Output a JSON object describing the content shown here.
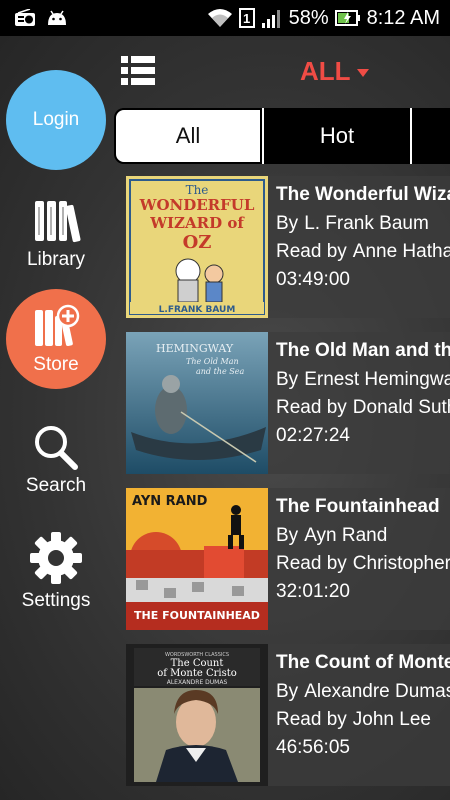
{
  "status": {
    "battery": "58%",
    "time": "8:12 AM",
    "sim": "1"
  },
  "header": {
    "filter": "ALL"
  },
  "tabs": [
    {
      "label": "All"
    },
    {
      "label": "Hot"
    }
  ],
  "nav": [
    {
      "label": "Login"
    },
    {
      "label": "Library"
    },
    {
      "label": "Store"
    },
    {
      "label": "Search"
    },
    {
      "label": "Settings"
    }
  ],
  "labels": {
    "by": "By",
    "read_by": "Read by"
  },
  "books": [
    {
      "title": "The Wonderful Wizard of Oz",
      "author": "L. Frank Baum",
      "narrator": "Anne Hathaway",
      "duration": "03:49:00",
      "cover_text": [
        "The",
        "WONDERFUL",
        "WIZARD of",
        "OZ",
        "L.FRANK BAUM"
      ]
    },
    {
      "title": "The Old Man and the Sea",
      "author": "Ernest Hemingway",
      "narrator": "Donald Sutherland",
      "duration": "02:27:24",
      "cover_text": [
        "HEMINGWAY",
        "The Old Man",
        "and the Sea"
      ]
    },
    {
      "title": "The Fountainhead",
      "author": "Ayn Rand",
      "narrator": "Christopher Hurt",
      "duration": "32:01:20",
      "cover_text": [
        "AYN RAND",
        "THE FOUNTAINHEAD"
      ]
    },
    {
      "title": "The Count of Monte Cristo",
      "author": "Alexandre Dumas",
      "narrator": "John Lee",
      "duration": "46:56:05",
      "cover_text": [
        "WORDSWORTH CLASSICS",
        "The Count",
        "of Monte Cristo",
        "ALEXANDRE DUMAS"
      ]
    }
  ],
  "colors": {
    "login": "#5fbdf0",
    "store": "#f0704b",
    "accent": "#f04c45"
  }
}
